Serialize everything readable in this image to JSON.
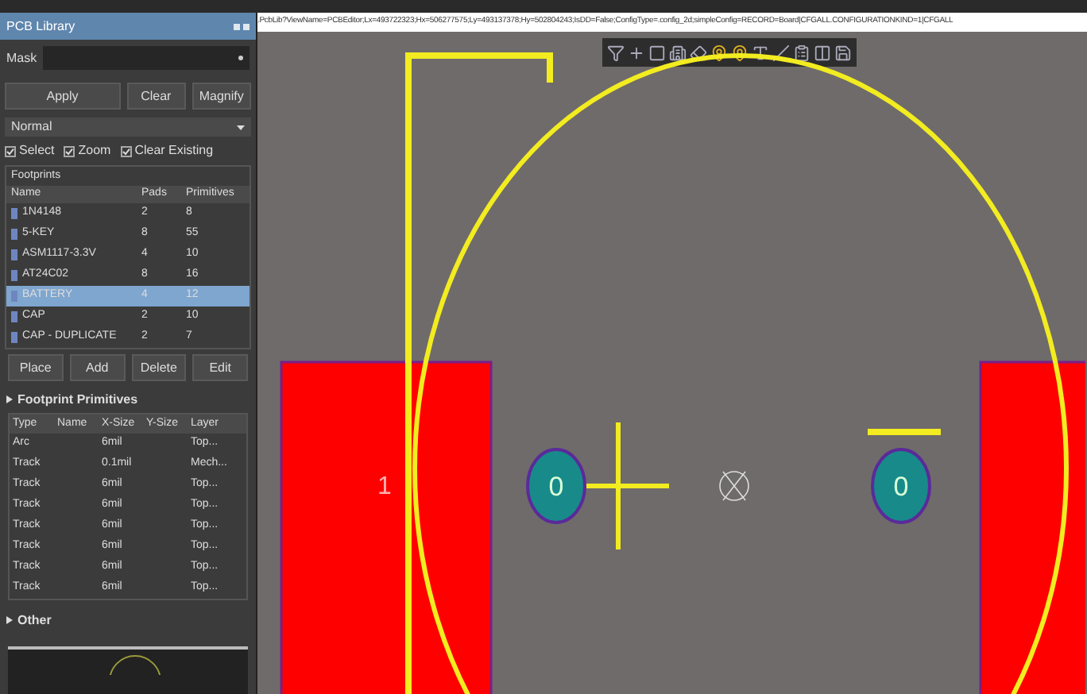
{
  "panel": {
    "title": "PCB Library",
    "mask": {
      "label": "Mask"
    },
    "buttons": [
      "Apply",
      "Clear",
      "Magnify"
    ],
    "mode": {
      "value": "Normal"
    },
    "options": [
      {
        "label": "Select",
        "checked": true
      },
      {
        "label": "Zoom",
        "checked": true
      },
      {
        "label": "Clear Existing",
        "checked": true
      }
    ],
    "footprints": {
      "title": "Footprints",
      "columns": [
        "Name",
        "Pads",
        "Primitives"
      ],
      "rows": [
        {
          "cells": [
            "1N4148",
            "2",
            "8"
          ],
          "selected": false
        },
        {
          "cells": [
            "5-KEY",
            "8",
            "55"
          ],
          "selected": false
        },
        {
          "cells": [
            "ASM1117-3.3V",
            "4",
            "10"
          ],
          "selected": false
        },
        {
          "cells": [
            "AT24C02",
            "8",
            "16"
          ],
          "selected": false
        },
        {
          "cells": [
            "BATTERY",
            "4",
            "12"
          ],
          "selected": true
        },
        {
          "cells": [
            "CAP",
            "2",
            "10"
          ],
          "selected": false
        },
        {
          "cells": [
            "CAP - DUPLICATE",
            "2",
            "7"
          ],
          "selected": false
        }
      ],
      "actions": [
        "Place",
        "Add",
        "Delete",
        "Edit"
      ]
    },
    "primitives": {
      "title": "Footprint Primitives",
      "columns": [
        "Type",
        "Name",
        "X-Size",
        "Y-Size",
        "Layer"
      ],
      "rows": [
        [
          "Arc",
          "",
          "6mil",
          "",
          "Top..."
        ],
        [
          "Track",
          "",
          "0.1mil",
          "",
          "Mech..."
        ],
        [
          "Track",
          "",
          "6mil",
          "",
          "Top..."
        ],
        [
          "Track",
          "",
          "6mil",
          "",
          "Top..."
        ],
        [
          "Track",
          "",
          "6mil",
          "",
          "Top..."
        ],
        [
          "Track",
          "",
          "6mil",
          "",
          "Top..."
        ],
        [
          "Track",
          "",
          "6mil",
          "",
          "Top..."
        ],
        [
          "Track",
          "",
          "6mil",
          "",
          "Top..."
        ]
      ]
    },
    "other": {
      "title": "Other"
    }
  },
  "editor": {
    "address": ".PcbLib?ViewName=PCBEditor;Lx=493722323;Hx=506277575;Ly=493137378;Hy=502804243;IsDD=False;ConfigType=.config_2d;simpleConfig=RECORD=Board|CFGALL.CONFIGURATIONKIND=1|CFGALL",
    "pads": [
      {
        "kind": "smd",
        "label": "1"
      },
      {
        "kind": "smd"
      },
      {
        "kind": "through",
        "label": "0"
      },
      {
        "kind": "through",
        "label": "0"
      }
    ]
  }
}
